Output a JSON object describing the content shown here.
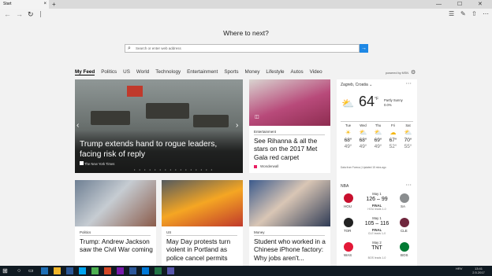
{
  "browser": {
    "tab_title": "Start",
    "new_tab": "+",
    "tab_close": "×",
    "min": "—",
    "max": "☐",
    "close": "✕"
  },
  "nav": {
    "back": "←",
    "forward": "→",
    "refresh": "↻"
  },
  "start": {
    "heading": "Where to next?",
    "search_placeholder": "Search or enter web address",
    "go": "→"
  },
  "categories": [
    "My Feed",
    "Politics",
    "US",
    "World",
    "Technology",
    "Entertainment",
    "Sports",
    "Money",
    "Lifestyle",
    "Autos",
    "Video"
  ],
  "powered_by": "powered by MSN",
  "hero": {
    "title": "Trump extends hand to rogue leaders, facing risk of reply",
    "source": "The New York Times",
    "dots": "• • • • • • • • • • • • • • • •"
  },
  "card2": {
    "tag": "Entertainment",
    "title": "See Rihanna & all the stars on the 2017 Met Gala red carpet",
    "source": "Wonderwall"
  },
  "weather": {
    "location": "Zagreb, Croatia",
    "location_caret": "⌄",
    "temp": "64",
    "unit": "°F",
    "condition": "Partly Sunny",
    "precip": "0.0%",
    "days": [
      {
        "name": "Tue",
        "hi": "68°",
        "lo": "49°",
        "icon": "☀"
      },
      {
        "name": "Wed",
        "hi": "68°",
        "lo": "49°",
        "icon": "⛅"
      },
      {
        "name": "Thu",
        "hi": "69°",
        "lo": "49°",
        "icon": "⛅"
      },
      {
        "name": "Fri",
        "hi": "67°",
        "lo": "52°",
        "icon": "☁"
      },
      {
        "name": "Sat",
        "hi": "70°",
        "lo": "55°",
        "icon": "⛅"
      }
    ],
    "footer": "Data from Foreca | Updated 15 mins ago",
    "more": "• • •"
  },
  "nba": {
    "label": "NBA",
    "games": [
      {
        "date": "May 1",
        "score": "126 – 99",
        "status": "FINAL",
        "note": "HOU leads 1-0",
        "home": "HOU",
        "away": "SA"
      },
      {
        "date": "May 1",
        "score": "105 – 116",
        "status": "FINAL",
        "note": "CLE leads 1-0",
        "home": "TOR",
        "away": "CLE"
      },
      {
        "date": "May 2",
        "score": "TNT",
        "status": "",
        "note": "BOS leads 1-0",
        "home": "WAS",
        "away": "BOS",
        "extra": "May 2"
      }
    ]
  },
  "bottom": [
    {
      "tag": "Politics",
      "title": "Trump: Andrew Jackson saw the Civil War coming"
    },
    {
      "tag": "US",
      "title": "May Day protests turn violent in Portland as police cancel permits"
    },
    {
      "tag": "Money",
      "title": "Student who worked in a Chinese iPhone factory: Why jobs aren't..."
    }
  ],
  "taskbar": {
    "time": "13:41",
    "date": "2.5.2017",
    "lang": "HRV"
  }
}
